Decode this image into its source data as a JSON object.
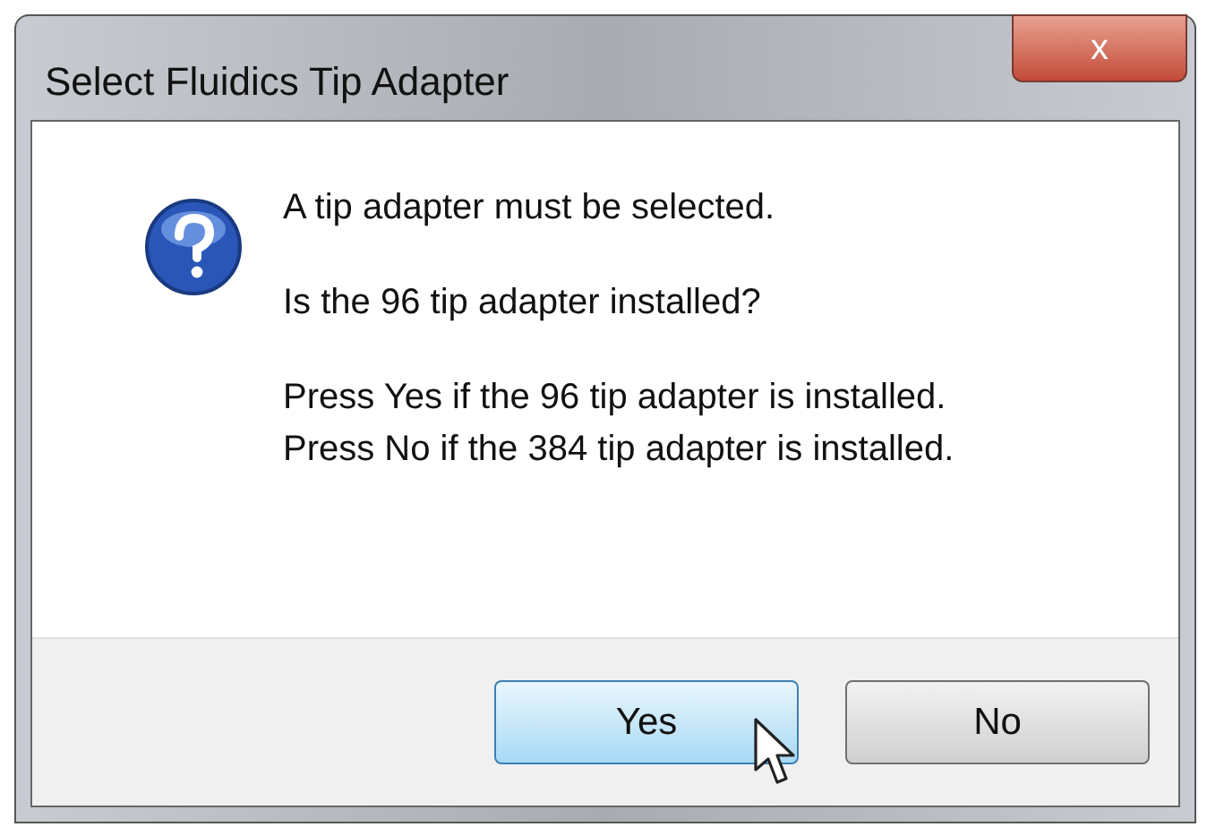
{
  "window": {
    "title": "Select Fluidics Tip Adapter",
    "close_label": "x"
  },
  "message": {
    "lines": [
      "A tip adapter must be selected.",
      "Is the 96 tip adapter installed?",
      "Press Yes if the 96 tip adapter is installed.\nPress No if the 384 tip adapter is installed."
    ]
  },
  "buttons": [
    {
      "label": "Yes",
      "highlighted": true
    },
    {
      "label": "No",
      "highlighted": false
    }
  ]
}
